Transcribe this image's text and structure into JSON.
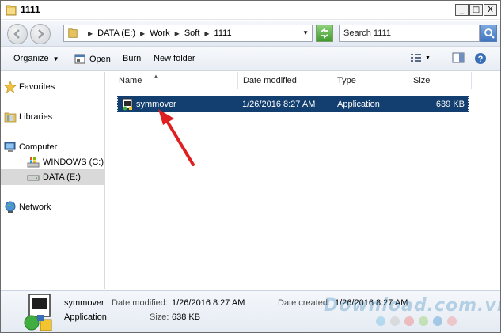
{
  "window": {
    "title": "1111"
  },
  "titlebar": {
    "minimize": "_",
    "maximize": "□",
    "close": "X"
  },
  "address": {
    "crumbs": [
      "DATA (E:)",
      "Work",
      "Soft",
      "1111"
    ]
  },
  "search": {
    "placeholder": "Search 1111"
  },
  "toolbar": {
    "organize": "Organize",
    "open": "Open",
    "burn": "Burn",
    "new_folder": "New folder"
  },
  "nav": {
    "favorites": "Favorites",
    "libraries": "Libraries",
    "computer": "Computer",
    "windows_drive": "WINDOWS (C:)",
    "data_drive": "DATA (E:)",
    "network": "Network"
  },
  "columns": {
    "name": "Name",
    "date_modified": "Date modified",
    "type": "Type",
    "size": "Size"
  },
  "files": [
    {
      "name": "symmover",
      "date_modified": "1/26/2016 8:27 AM",
      "type": "Application",
      "size": "639 KB"
    }
  ],
  "details": {
    "name": "symmover",
    "type": "Application",
    "date_modified_label": "Date modified:",
    "date_modified": "1/26/2016 8:27 AM",
    "size_label": "Size:",
    "size": "638 KB",
    "date_created_label": "Date created:",
    "date_created": "1/26/2016 8:27 AM"
  },
  "watermark": {
    "text": "Download.com.vn"
  },
  "colors": {
    "selection": "#123f6f",
    "arrow": "#e02020",
    "nav_selected": "#d9d9d9"
  }
}
